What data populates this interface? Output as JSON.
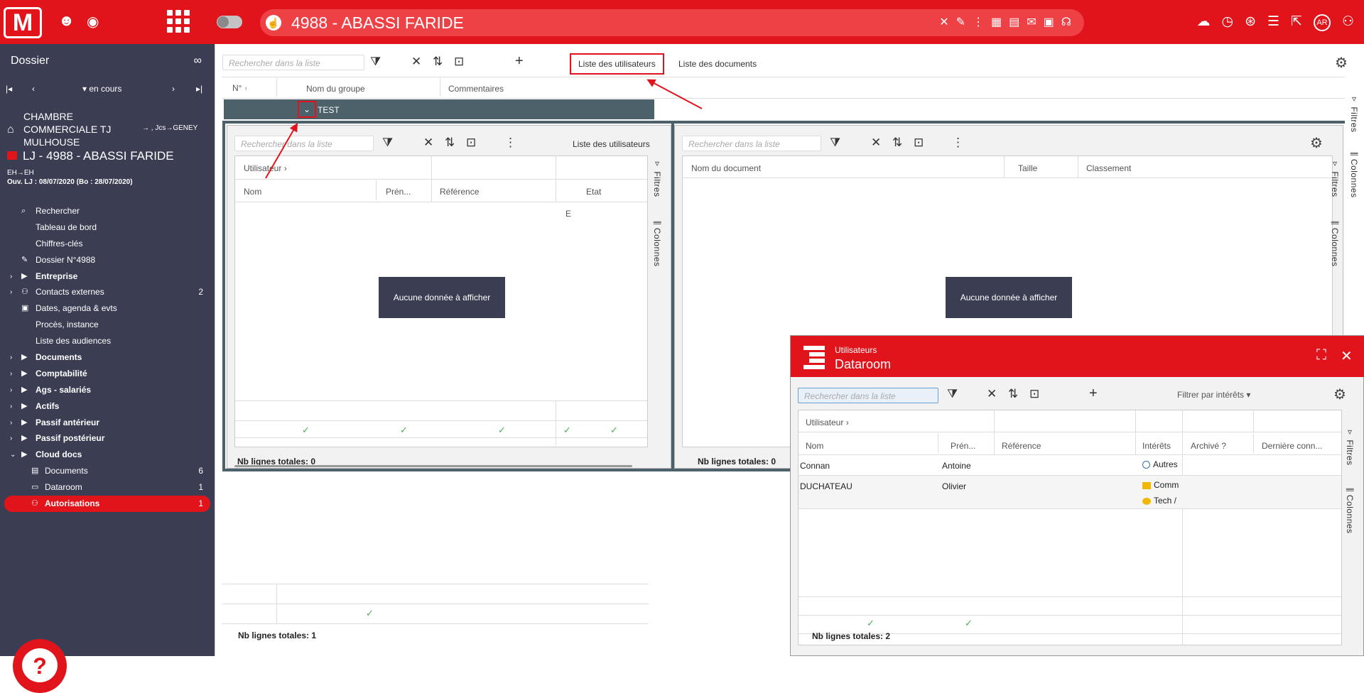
{
  "topbar": {
    "logo": "M",
    "dossier_title": "4988 - ABASSI FARIDE",
    "user_initials": "AR"
  },
  "sidebar": {
    "header": "Dossier",
    "nav_filter": "en cours",
    "org_line1": "CHAMBRE",
    "org_line2": "COMMERCIALE TJ",
    "org_line3": "MULHOUSE",
    "jcs": "→ , Jcs→GENEY",
    "lj_title": "LJ - 4988 - ABASSI FARIDE",
    "eh": "EH→EH",
    "ouv": "Ouv. LJ : 08/07/2020 (Bo : 28/07/2020)",
    "items": [
      {
        "label": "Rechercher",
        "count": "",
        "icon": "search-icon",
        "chevron": false,
        "bold": false
      },
      {
        "label": "Tableau de bord",
        "count": "",
        "icon": "",
        "chevron": false,
        "bold": false
      },
      {
        "label": "Chiffres-clés",
        "count": "",
        "icon": "",
        "chevron": false,
        "bold": false
      },
      {
        "label": "Dossier N°4988",
        "count": "",
        "icon": "pencil-icon",
        "chevron": false,
        "bold": false
      },
      {
        "label": "Entreprise",
        "count": "",
        "icon": "label-icon",
        "chevron": true,
        "bold": true
      },
      {
        "label": "Contacts externes",
        "count": "2",
        "icon": "people-icon",
        "chevron": true,
        "bold": false
      },
      {
        "label": "Dates, agenda & evts",
        "count": "",
        "icon": "calendar-icon",
        "chevron": false,
        "bold": false
      },
      {
        "label": "Procès, instance",
        "count": "",
        "icon": "",
        "chevron": false,
        "bold": false
      },
      {
        "label": "Liste des audiences",
        "count": "",
        "icon": "",
        "chevron": false,
        "bold": false
      },
      {
        "label": "Documents",
        "count": "",
        "icon": "label-icon",
        "chevron": true,
        "bold": true
      },
      {
        "label": "Comptabilité",
        "count": "",
        "icon": "label-icon",
        "chevron": true,
        "bold": true
      },
      {
        "label": "Ags - salariés",
        "count": "",
        "icon": "label-icon",
        "chevron": true,
        "bold": true
      },
      {
        "label": "Actifs",
        "count": "",
        "icon": "label-icon",
        "chevron": true,
        "bold": true
      },
      {
        "label": "Passif antérieur",
        "count": "",
        "icon": "label-icon",
        "chevron": true,
        "bold": true
      },
      {
        "label": "Passif postérieur",
        "count": "",
        "icon": "label-icon",
        "chevron": true,
        "bold": true
      },
      {
        "label": "Cloud docs",
        "count": "",
        "icon": "label-icon",
        "chevron": true,
        "bold": true
      },
      {
        "label": "Documents",
        "count": "6",
        "icon": "doc-search-icon",
        "chevron": false,
        "bold": false
      },
      {
        "label": "Dataroom",
        "count": "1",
        "icon": "folder-icon",
        "chevron": false,
        "bold": false
      },
      {
        "label": "Autorisations",
        "count": "1",
        "icon": "people-icon",
        "chevron": false,
        "bold": true
      }
    ]
  },
  "main": {
    "search_placeholder": "Rechercher dans la liste",
    "tab_users": "Liste des utilisateurs",
    "tab_docs": "Liste des documents",
    "col_num": "N°",
    "col_group": "Nom du groupe",
    "col_comment": "Commentaires",
    "group_row": "TEST",
    "side_filters": "Filtres",
    "side_columns": "Colonnes",
    "footer_label": "Nb lignes totales:",
    "footer_count": "1"
  },
  "users_panel": {
    "search_placeholder": "Rechercher dans la liste",
    "title": "Liste des utilisateurs",
    "group_header": "Utilisateur",
    "cols": [
      "Nom",
      "Prén...",
      "Référence",
      "Etat"
    ],
    "etat_value": "E",
    "empty": "Aucune donnée à afficher",
    "footer_label": "Nb lignes totales:",
    "footer_count": "0"
  },
  "docs_panel": {
    "search_placeholder": "Rechercher dans la liste",
    "cols": [
      "Nom du document",
      "Taille",
      "Classement"
    ],
    "empty": "Aucune donnée à afficher",
    "footer_label": "Nb lignes totales:",
    "footer_count": "0"
  },
  "popup": {
    "subtitle": "Utilisateurs",
    "title": "Dataroom",
    "search_placeholder": "Rechercher dans la liste",
    "filter_interests": "Filtrer par intérêts",
    "group_header": "Utilisateur",
    "cols": [
      "Nom",
      "Prén...",
      "Référence",
      "Intérêts",
      "Archivé ?",
      "Dernière conn..."
    ],
    "rows": [
      {
        "nom": "Connan",
        "prenom": "Antoine",
        "interest": "Autres"
      },
      {
        "nom": "DUCHATEAU",
        "prenom": "Olivier",
        "interest": "Comm",
        "interest2": "Tech /"
      }
    ],
    "footer_label": "Nb lignes totales:",
    "footer_count": "2"
  }
}
